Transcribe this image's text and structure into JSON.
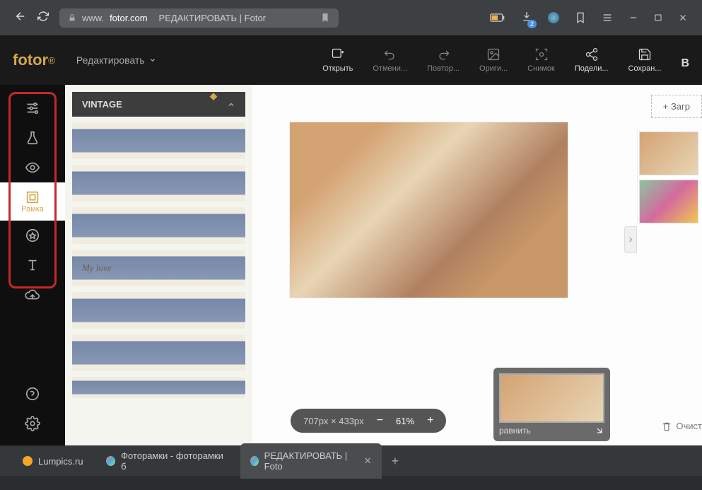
{
  "browser": {
    "url_prefix": "www.",
    "url_host": "fotor.com",
    "page_title": "РЕДАКТИРОВАТЬ | Fotor",
    "download_count": "2"
  },
  "app": {
    "logo": "fotor",
    "edit_menu": "Редактировать"
  },
  "toolbar": {
    "open": "Открыть",
    "undo": "Отмени...",
    "redo": "Повтор...",
    "original": "Ориги...",
    "snapshot": "Снимок",
    "share": "Подели...",
    "save": "Сохран..."
  },
  "sidenav": {
    "active_label": "Рамка"
  },
  "panel": {
    "header": "VINTAGE",
    "frame_label": "My love"
  },
  "canvas": {
    "upload": "Загр",
    "dimensions": "707px × 433px",
    "zoom": "61%",
    "compare": "равнить",
    "clear": "Очист"
  },
  "tabs": [
    {
      "label": "Lumpics.ru",
      "favicon": "#f5a623"
    },
    {
      "label": "Фоторамки - фоторамки б",
      "favicon": "linear-gradient(135deg,#e84,#4ae,#ae4)"
    },
    {
      "label": "РЕДАКТИРОВАТЬ | Foto",
      "favicon": "linear-gradient(135deg,#e84,#4ae,#ae4)",
      "active": true
    }
  ]
}
